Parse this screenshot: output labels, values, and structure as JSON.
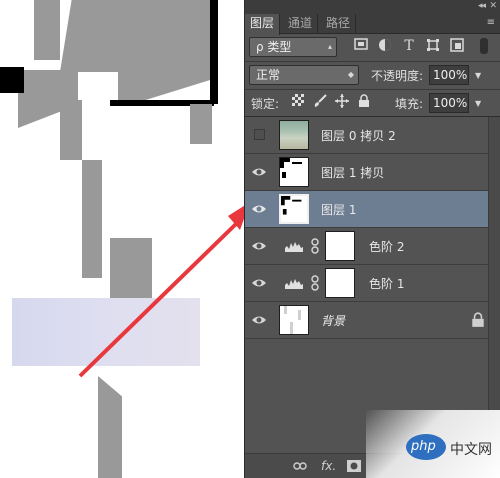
{
  "panel": {
    "collapse_glyph": "◂◂",
    "close_glyph": "✕",
    "menu_glyph": "≡",
    "tabs": [
      {
        "label": "图层",
        "active": true
      },
      {
        "label": "通道",
        "active": false
      },
      {
        "label": "路径",
        "active": false
      }
    ],
    "filter": {
      "label": "ρ 类型"
    },
    "blend_mode": "正常",
    "opacity": {
      "label": "不透明度:",
      "value": "100%"
    },
    "lock_label": "锁定:",
    "fill": {
      "label": "填充:",
      "value": "100%"
    }
  },
  "layers": [
    {
      "name": "图层 0 拷贝 2",
      "visible": false,
      "selected": false,
      "kind": "photo"
    },
    {
      "name": "图层 1 拷贝",
      "visible": true,
      "selected": false,
      "kind": "mask"
    },
    {
      "name": "图层 1",
      "visible": true,
      "selected": true,
      "kind": "mask"
    },
    {
      "name": "色阶 2",
      "visible": true,
      "selected": false,
      "kind": "adjustment"
    },
    {
      "name": "色阶 1",
      "visible": true,
      "selected": false,
      "kind": "adjustment"
    },
    {
      "name": "背景",
      "visible": true,
      "selected": false,
      "kind": "background",
      "locked": true
    }
  ],
  "bottombar": {
    "fx_label": "fx."
  },
  "watermark": {
    "logo": "php",
    "text": "中文网"
  },
  "colors": {
    "panel_bg": "#535353",
    "selected_row": "#6e7e92",
    "arrow": "#e8383d"
  }
}
